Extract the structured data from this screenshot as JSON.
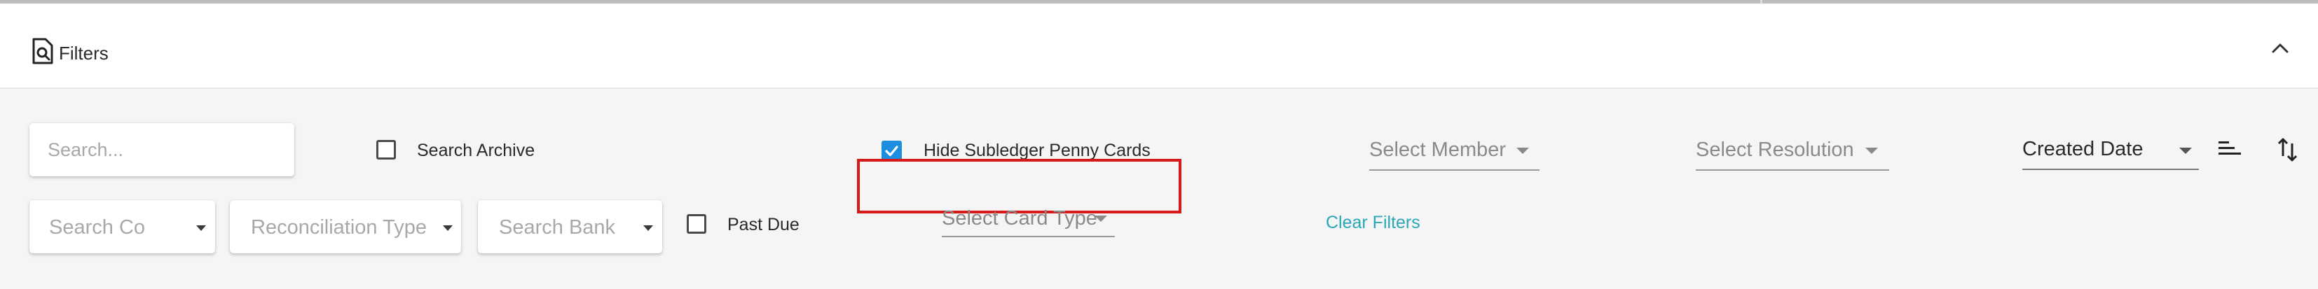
{
  "header": {
    "title": "Filters",
    "filters_icon": "search-document-icon",
    "collapse_icon": "chevron-up-icon"
  },
  "filters": {
    "search": {
      "placeholder": "Search...",
      "value": ""
    },
    "search_archive": {
      "label": "Search Archive",
      "checked": false
    },
    "hide_subledger": {
      "label": "Hide Subledger Penny Cards",
      "checked": true
    },
    "select_member": {
      "placeholder": "Select Member"
    },
    "select_resolution": {
      "placeholder": "Select Resolution"
    },
    "sort_field": {
      "value": "Created Date"
    },
    "sort_icon": "sort-lines-icon",
    "sort_direction_icon": "sort-direction-icon",
    "search_co": {
      "placeholder": "Search Co"
    },
    "reconciliation_type": {
      "placeholder": "Reconciliation Type"
    },
    "search_bank": {
      "placeholder": "Search Bank"
    },
    "past_due": {
      "label": "Past Due",
      "checked": false
    },
    "select_card_type": {
      "placeholder": "Select Card Type"
    },
    "clear_filters": "Clear Filters"
  },
  "colors": {
    "accent_checkbox": "#1b8ee0",
    "link": "#2aa7b8",
    "highlight": "#d61a1a"
  }
}
